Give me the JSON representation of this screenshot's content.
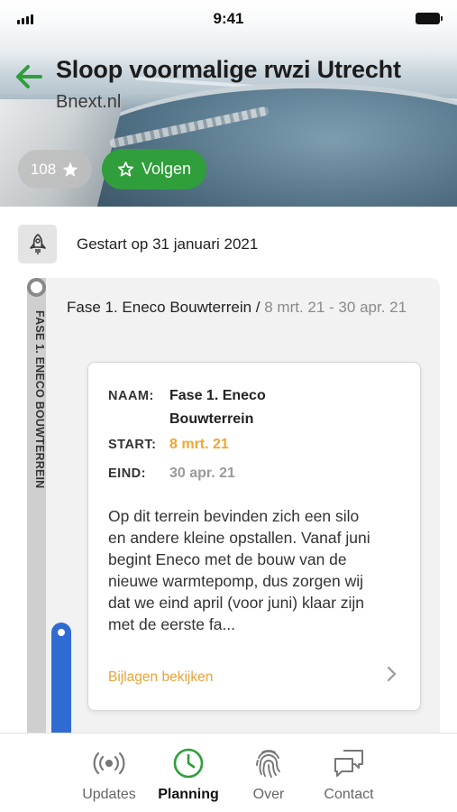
{
  "status_bar": {
    "time": "9:41"
  },
  "header": {
    "title": "Sloop voormalige rwzi Utrecht",
    "subtitle": "Bnext.nl",
    "star_count": "108",
    "follow_label": "Volgen"
  },
  "timeline": {
    "started_text": "Gestart op 31 januari 2021",
    "phase": {
      "vertical_label": "FASE 1. ENECO BOUWTERREIN",
      "title": "Fase 1. Eneco Bouwterrein /",
      "range": "8 mrt. 21 - 30 apr. 21",
      "details": {
        "name_key": "NAAM:",
        "name_value": "Fase 1. Eneco Bouwterrein",
        "start_key": "START:",
        "start_value": "8 mrt. 21",
        "end_key": "EIND:",
        "end_value": "30 apr. 21",
        "description": "Op dit terrein bevinden zich een silo en andere kleine opstallen. Vanaf juni begint Eneco met de bouw van de nieuwe warmtepomp, dus zorgen wij dat we eind april (voor juni) klaar zijn met de eerste fa...",
        "attachments_label": "Bijlagen bekijken"
      }
    }
  },
  "tabs": [
    {
      "label": "Updates",
      "icon": "broadcast-icon",
      "active": false
    },
    {
      "label": "Planning",
      "icon": "clock-icon",
      "active": true
    },
    {
      "label": "Over",
      "icon": "fingerprint-icon",
      "active": false
    },
    {
      "label": "Contact",
      "icon": "chat-icon",
      "active": false
    }
  ],
  "colors": {
    "brand_green": "#2f9e3b",
    "start_orange": "#f2a630",
    "progress_blue": "#2f6bd3"
  }
}
